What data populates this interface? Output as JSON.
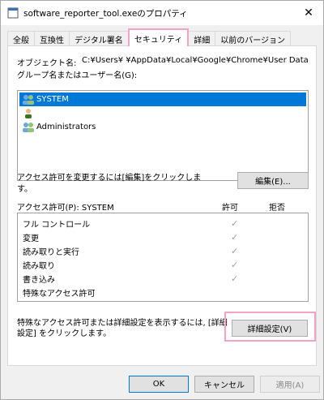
{
  "window": {
    "title": "software_reporter_tool.exeのプロパティ",
    "close_glyph": "✕"
  },
  "tabs": [
    {
      "label": "全般"
    },
    {
      "label": "互換性"
    },
    {
      "label": "デジタル署名"
    },
    {
      "label": "セキュリティ",
      "active": true
    },
    {
      "label": "詳細"
    },
    {
      "label": "以前のバージョン"
    }
  ],
  "security": {
    "object_name_label": "オブジェクト名:",
    "object_name_value": "C:¥Users¥          ¥AppData¥Local¥Google¥Chrome¥User Data¥Sw",
    "group_label": "グループ名またはユーザー名(G):",
    "users": [
      {
        "name": "SYSTEM",
        "selected": true,
        "icon": "users-group-icon"
      },
      {
        "name": "",
        "selected": false,
        "icon": "user-icon"
      },
      {
        "name": "Administrators",
        "selected": false,
        "icon": "users-group-icon"
      }
    ],
    "change_hint": "アクセス許可を変更するには[編集]をクリックしま\nす。",
    "edit_button": "編集(E)...",
    "perm_header": "アクセス許可(P): SYSTEM",
    "allow_header": "許可",
    "deny_header": "拒否",
    "permissions": [
      {
        "name": "フル コントロール",
        "allow": true
      },
      {
        "name": "変更",
        "allow": true
      },
      {
        "name": "読み取りと実行",
        "allow": true
      },
      {
        "name": "読み取り",
        "allow": true
      },
      {
        "name": "書き込み",
        "allow": true
      },
      {
        "name": "特殊なアクセス許可",
        "allow": false
      }
    ],
    "advanced_hint": "特殊なアクセス許可または詳細設定を表示するには, [詳細\n設定] をクリックします。",
    "advanced_button": "詳細設定(V)"
  },
  "footer": {
    "ok": "OK",
    "cancel": "キャンセル",
    "apply": "適用(A)"
  },
  "check_glyph": "✓"
}
